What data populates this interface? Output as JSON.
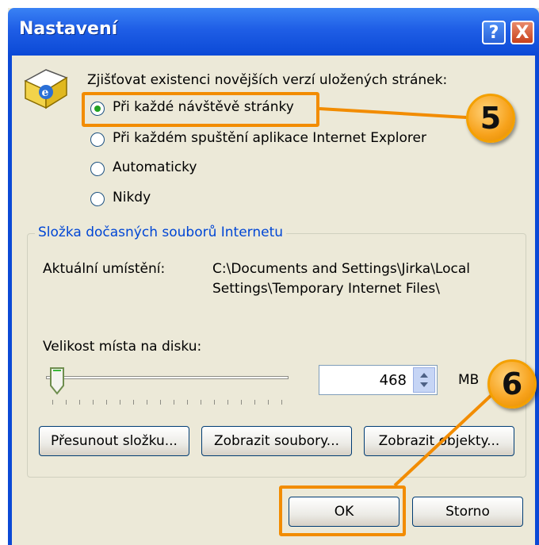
{
  "window": {
    "title": "Nastavení",
    "help_glyph": "?",
    "close_glyph": "X"
  },
  "check": {
    "label": "Zjišťovat existenci novějších verzí uložených stránek:",
    "options": [
      {
        "label": "Při každé návštěvě stránky",
        "selected": true
      },
      {
        "label": "Při každém spuštění aplikace Internet Explorer",
        "selected": false
      },
      {
        "label": "Automaticky",
        "selected": false
      },
      {
        "label": "Nikdy",
        "selected": false
      }
    ]
  },
  "temp_folder": {
    "group_title": "Složka dočasných souborů Internetu",
    "location_label": "Aktuální umístění:",
    "location_line1": "C:\\Documents and Settings\\Jirka\\Local",
    "location_line2": "Settings\\Temporary Internet Files\\",
    "disk_label": "Velikost místa na disku:",
    "disk_value": "468",
    "disk_unit": "MB",
    "slider_level": 0.03,
    "buttons": {
      "move": "Přesunout složku...",
      "view_files": "Zobrazit soubory...",
      "view_objects": "Zobrazit objekty..."
    }
  },
  "dialog_buttons": {
    "ok": "OK",
    "cancel": "Storno"
  },
  "callouts": {
    "step5": "5",
    "step6": "6"
  },
  "colors": {
    "highlight": "#f28c00",
    "titlebar": "#0b49d6",
    "group_title": "#0046d5"
  },
  "icons": [
    "ie-folder-icon",
    "help-icon",
    "close-icon",
    "spin-arrows-icon"
  ]
}
